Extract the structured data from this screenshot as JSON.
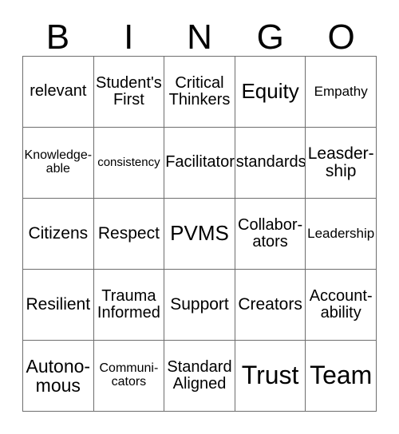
{
  "card": {
    "header_letters": [
      "B",
      "I",
      "N",
      "G",
      "O"
    ],
    "columns": 5,
    "rows": 5,
    "colors": {
      "text": "#000000",
      "background": "#ffffff",
      "grid_line": "#6e6e6e",
      "outer_border": "#9a9a9a"
    },
    "cells": [
      [
        {
          "text": "relevant",
          "size": "fs-m"
        },
        {
          "text": "Student's\nFirst",
          "size": "fs-m"
        },
        {
          "text": "Critical\nThinkers",
          "size": "fs-m"
        },
        {
          "text": "Equity",
          "size": "fs-xl"
        },
        {
          "text": "Empathy",
          "size": "fs-s"
        }
      ],
      [
        {
          "text": "Knowledge-\nable",
          "size": "fs-xs"
        },
        {
          "text": "consistency",
          "size": "fs-xxs"
        },
        {
          "text": "Facilitator",
          "size": "fs-m"
        },
        {
          "text": "standards",
          "size": "fs-m"
        },
        {
          "text": "Leasder-\nship",
          "size": "fs-ml"
        }
      ],
      [
        {
          "text": "Citizens",
          "size": "fs-ml"
        },
        {
          "text": "Respect",
          "size": "fs-ml"
        },
        {
          "text": "PVMS",
          "size": "fs-xl"
        },
        {
          "text": "Collabor-\nators",
          "size": "fs-m"
        },
        {
          "text": "Leadership",
          "size": "fs-s"
        }
      ],
      [
        {
          "text": "Resilient",
          "size": "fs-ml"
        },
        {
          "text": "Trauma\nInformed",
          "size": "fs-m"
        },
        {
          "text": "Support",
          "size": "fs-ml"
        },
        {
          "text": "Creators",
          "size": "fs-ml"
        },
        {
          "text": "Account-\nability",
          "size": "fs-m"
        }
      ],
      [
        {
          "text": "Autono-\nmous",
          "size": "fs-l"
        },
        {
          "text": "Communi-\ncators",
          "size": "fs-xs"
        },
        {
          "text": "Standard\nAligned",
          "size": "fs-m"
        },
        {
          "text": "Trust",
          "size": "fs-xxl"
        },
        {
          "text": "Team",
          "size": "fs-xxl"
        }
      ]
    ]
  }
}
